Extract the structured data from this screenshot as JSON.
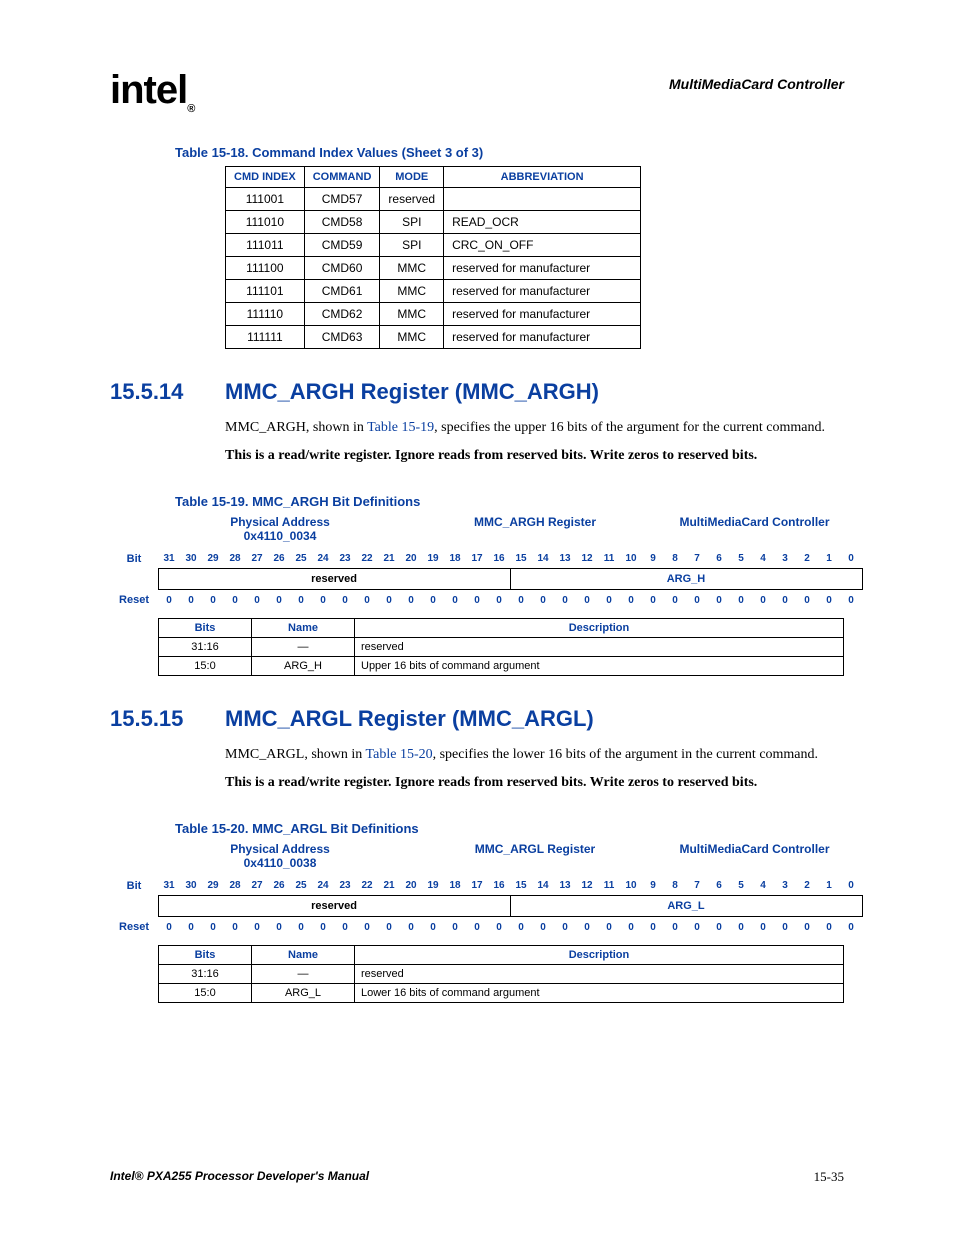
{
  "header": {
    "logo_text": "intel",
    "chapter_title": "MultiMediaCard Controller"
  },
  "table18": {
    "caption": "Table 15-18. Command Index Values (Sheet 3 of 3)",
    "headers": [
      "CMD INDEX",
      "COMMAND",
      "MODE",
      "ABBREVIATION"
    ],
    "rows": [
      [
        "111001",
        "CMD57",
        "reserved",
        ""
      ],
      [
        "111010",
        "CMD58",
        "SPI",
        "READ_OCR"
      ],
      [
        "111011",
        "CMD59",
        "SPI",
        "CRC_ON_OFF"
      ],
      [
        "111100",
        "CMD60",
        "MMC",
        "reserved for manufacturer"
      ],
      [
        "111101",
        "CMD61",
        "MMC",
        "reserved for manufacturer"
      ],
      [
        "111110",
        "CMD62",
        "MMC",
        "reserved for manufacturer"
      ],
      [
        "111111",
        "CMD63",
        "MMC",
        "reserved for manufacturer"
      ]
    ]
  },
  "section14": {
    "num": "15.5.14",
    "title": "MMC_ARGH Register (MMC_ARGH)",
    "para_pre": "MMC_ARGH, shown in ",
    "para_ref": "Table 15-19",
    "para_post": ", specifies the upper 16 bits of the argument for the current command.",
    "bold": "This is a read/write register. Ignore reads from reserved bits. Write zeros to reserved bits."
  },
  "table19": {
    "caption": "Table 15-19. MMC_ARGH Bit Definitions",
    "phys1": "Physical Address",
    "phys2": "0x4110_0034",
    "regname": "MMC_ARGH Register",
    "controller": "MultiMediaCard Controller",
    "bit_label": "Bit",
    "reset_label": "Reset",
    "bits": [
      "31",
      "30",
      "29",
      "28",
      "27",
      "26",
      "25",
      "24",
      "23",
      "22",
      "21",
      "20",
      "19",
      "18",
      "17",
      "16",
      "15",
      "14",
      "13",
      "12",
      "11",
      "10",
      "9",
      "8",
      "7",
      "6",
      "5",
      "4",
      "3",
      "2",
      "1",
      "0"
    ],
    "field_reserved": "reserved",
    "field_arg": "ARG_H",
    "reset_values": [
      "0",
      "0",
      "0",
      "0",
      "0",
      "0",
      "0",
      "0",
      "0",
      "0",
      "0",
      "0",
      "0",
      "0",
      "0",
      "0",
      "0",
      "0",
      "0",
      "0",
      "0",
      "0",
      "0",
      "0",
      "0",
      "0",
      "0",
      "0",
      "0",
      "0",
      "0",
      "0"
    ],
    "fheaders": [
      "Bits",
      "Name",
      "Description"
    ],
    "frows": [
      [
        "31:16",
        "—",
        "reserved"
      ],
      [
        "15:0",
        "ARG_H",
        "Upper 16 bits of command argument"
      ]
    ]
  },
  "section15": {
    "num": "15.5.15",
    "title": "MMC_ARGL Register (MMC_ARGL)",
    "para_pre": "MMC_ARGL, shown in ",
    "para_ref": "Table 15-20",
    "para_post": ", specifies the lower 16 bits of the argument in the current command.",
    "bold": "This is a read/write register. Ignore reads from reserved bits. Write zeros to reserved bits."
  },
  "table20": {
    "caption": "Table 15-20. MMC_ARGL Bit Definitions",
    "phys1": "Physical Address",
    "phys2": "0x4110_0038",
    "regname": "MMC_ARGL Register",
    "controller": "MultiMediaCard Controller",
    "bit_label": "Bit",
    "reset_label": "Reset",
    "bits": [
      "31",
      "30",
      "29",
      "28",
      "27",
      "26",
      "25",
      "24",
      "23",
      "22",
      "21",
      "20",
      "19",
      "18",
      "17",
      "16",
      "15",
      "14",
      "13",
      "12",
      "11",
      "10",
      "9",
      "8",
      "7",
      "6",
      "5",
      "4",
      "3",
      "2",
      "1",
      "0"
    ],
    "field_reserved": "reserved",
    "field_arg": "ARG_L",
    "reset_values": [
      "0",
      "0",
      "0",
      "0",
      "0",
      "0",
      "0",
      "0",
      "0",
      "0",
      "0",
      "0",
      "0",
      "0",
      "0",
      "0",
      "0",
      "0",
      "0",
      "0",
      "0",
      "0",
      "0",
      "0",
      "0",
      "0",
      "0",
      "0",
      "0",
      "0",
      "0",
      "0"
    ],
    "fheaders": [
      "Bits",
      "Name",
      "Description"
    ],
    "frows": [
      [
        "31:16",
        "—",
        "reserved"
      ],
      [
        "15:0",
        "ARG_L",
        "Lower 16 bits of command argument"
      ]
    ]
  },
  "footer": {
    "left": "Intel® PXA255 Processor Developer's Manual",
    "right": "15-35"
  }
}
